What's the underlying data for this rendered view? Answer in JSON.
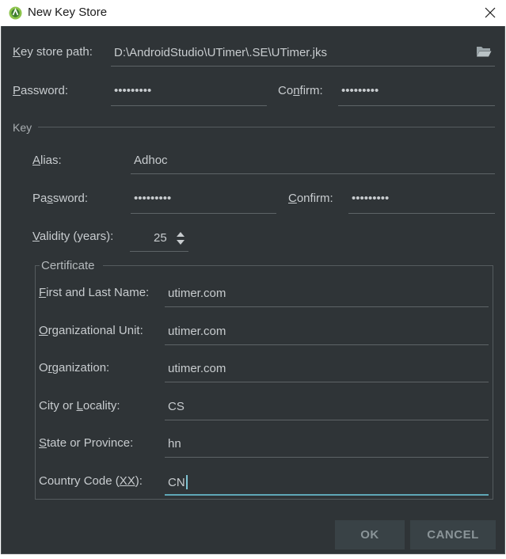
{
  "window": {
    "title": "New Key Store"
  },
  "keystore": {
    "path_label_mn": "K",
    "path_label_rest": "ey store path:",
    "path_value": "D:\\AndroidStudio\\UTimer\\.SE\\UTimer.jks",
    "password_label_mn": "P",
    "password_label_rest": "assword:",
    "password_value": "•••••••••",
    "confirm_label_pre": "Co",
    "confirm_label_mn": "n",
    "confirm_label_rest": "firm:",
    "confirm_value": "•••••••••"
  },
  "key": {
    "section_label": "Key",
    "alias_label_mn": "A",
    "alias_label_rest": "lias:",
    "alias_value": "Adhoc",
    "password_label_pre": "Pa",
    "password_label_mn": "s",
    "password_label_rest": "sword:",
    "password_value": "•••••••••",
    "confirm_label_mn": "C",
    "confirm_label_rest": "onfirm:",
    "confirm_value": "•••••••••",
    "validity_label_mn": "V",
    "validity_label_rest": "alidity (years):",
    "validity_value": "25"
  },
  "certificate": {
    "section_label": "Certificate",
    "fields": [
      {
        "pre": "",
        "mn": "F",
        "rest": "irst and Last Name:",
        "value": "utimer.com"
      },
      {
        "pre": "",
        "mn": "O",
        "rest": "rganizational Unit:",
        "value": "utimer.com"
      },
      {
        "pre": "O",
        "mn": "r",
        "rest": "ganization:",
        "value": "utimer.com"
      },
      {
        "pre": "City or ",
        "mn": "L",
        "rest": "ocality:",
        "value": "CS"
      },
      {
        "pre": "",
        "mn": "S",
        "rest": "tate or Province:",
        "value": "hn"
      },
      {
        "pre": "Country Code (",
        "mn": "XX",
        "rest": "):",
        "value": "CN"
      }
    ]
  },
  "buttons": {
    "ok": "OK",
    "cancel": "CANCEL"
  },
  "colors": {
    "dialog_bg": "#2f3437",
    "text": "#c8cccf",
    "accent": "#5fa7b6",
    "button_bg": "#394246"
  }
}
